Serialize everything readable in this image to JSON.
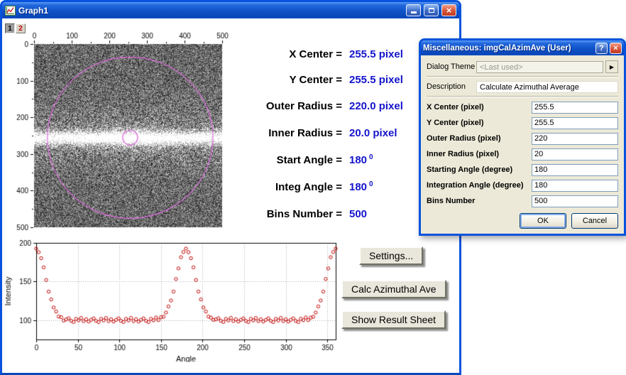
{
  "graph_window": {
    "title": "Graph1",
    "tabs": [
      "1",
      "2"
    ]
  },
  "window_controls": {
    "close": "×"
  },
  "annotations": [
    {
      "label": "X Center = ",
      "value": "255.5 pixel"
    },
    {
      "label": "Y Center = ",
      "value": "255.5 pixel"
    },
    {
      "label": "Outer Radius = ",
      "value": "220.0 pixel"
    },
    {
      "label": "Inner Radius = ",
      "value": "20.0 pixel"
    },
    {
      "label": "Start Angle = ",
      "value": "180",
      "sup": "0"
    },
    {
      "label": "Integ Angle = ",
      "value": "180",
      "sup": "0"
    },
    {
      "label": "Bins Number = ",
      "value": "500"
    }
  ],
  "graph_buttons": {
    "settings": "Settings...",
    "calc": "Calc Azimuthal Ave",
    "show": "Show Result Sheet"
  },
  "dialog": {
    "title": "Miscellaneous: imgCalAzimAve (User)",
    "help_glyph": "?",
    "close_glyph": "×",
    "theme_label": "Dialog Theme",
    "theme_value": "<Last used>",
    "theme_arrow": "▶",
    "description_label": "Description",
    "description_value": "Calculate Azimuthal Average",
    "fields": [
      {
        "label": "X Center (pixel)",
        "value": "255.5"
      },
      {
        "label": "Y Center (pixel)",
        "value": "255.5"
      },
      {
        "label": "Outer Radius (pixel)",
        "value": "220"
      },
      {
        "label": "Inner Radius (pixel)",
        "value": "20"
      },
      {
        "label": "Starting Angle (degree)",
        "value": "180"
      },
      {
        "label": "Integration Angle (degree)",
        "value": "180"
      },
      {
        "label": "Bins Number",
        "value": "500"
      }
    ],
    "ok_label": "OK",
    "cancel_label": "Cancel"
  },
  "chart_data": [
    {
      "type": "heatmap",
      "title": "FFT-magnitude grayscale noise image with bright horizontal center band",
      "xlim": [
        0,
        500
      ],
      "ylim": [
        0,
        500
      ],
      "y_direction": "down",
      "x_ticks": [
        0,
        100,
        200,
        300,
        400,
        500
      ],
      "y_ticks": [
        0,
        100,
        200,
        300,
        400,
        500
      ],
      "overlay_color": "#E06CE0",
      "overlays": [
        {
          "shape": "circle",
          "cx": 255.5,
          "cy": 255.5,
          "r": 220,
          "name": "outer-radius-roi"
        },
        {
          "shape": "circle",
          "cx": 255.5,
          "cy": 255.5,
          "r": 20,
          "name": "inner-radius-roi"
        }
      ]
    },
    {
      "type": "scatter",
      "title": "",
      "xlabel": "Angle",
      "ylabel": "Intensity",
      "xlim": [
        0,
        360
      ],
      "ylim": [
        75,
        200
      ],
      "x_ticks": [
        0,
        50,
        100,
        150,
        200,
        250,
        300,
        350
      ],
      "y_ticks": [
        100,
        150,
        200
      ],
      "grid": true,
      "legend": "none",
      "marker": "open-circle",
      "color": "#C00000",
      "points": [
        [
          0,
          192.6
        ],
        [
          3,
          187.9
        ],
        [
          6,
          180.2
        ],
        [
          9,
          168.3
        ],
        [
          12,
          152
        ],
        [
          15,
          137
        ],
        [
          18,
          126.8
        ],
        [
          21,
          116.4
        ],
        [
          24,
          111.2
        ],
        [
          27,
          104.7
        ],
        [
          30,
          103.9
        ],
        [
          33,
          99.5
        ],
        [
          36,
          101
        ],
        [
          39,
          102.5
        ],
        [
          42,
          99.2
        ],
        [
          45,
          97.6
        ],
        [
          48,
          101.7
        ],
        [
          51,
          99.7
        ],
        [
          54,
          102.9
        ],
        [
          57,
          98.8
        ],
        [
          60,
          101.2
        ],
        [
          63,
          98.2
        ],
        [
          66,
          100.4
        ],
        [
          69,
          102.3
        ],
        [
          72,
          99.1
        ],
        [
          75,
          97.6
        ],
        [
          78,
          101.7
        ],
        [
          81,
          99.7
        ],
        [
          84,
          102.9
        ],
        [
          87,
          98.8
        ],
        [
          90,
          101.2
        ],
        [
          93,
          98.2
        ],
        [
          96,
          100.4
        ],
        [
          99,
          102.3
        ],
        [
          102,
          99.1
        ],
        [
          105,
          97.6
        ],
        [
          108,
          101.7
        ],
        [
          111,
          99.7
        ],
        [
          114,
          102.9
        ],
        [
          117,
          98.8
        ],
        [
          120,
          101.2
        ],
        [
          123,
          98.2
        ],
        [
          126,
          100.4
        ],
        [
          129,
          102.3
        ],
        [
          132,
          99.1
        ],
        [
          135,
          97.6
        ],
        [
          138,
          101.7
        ],
        [
          141,
          99.7
        ],
        [
          144,
          103.5
        ],
        [
          147,
          100.1
        ],
        [
          150,
          103.9
        ],
        [
          153,
          104.4
        ],
        [
          156,
          109.9
        ],
        [
          159,
          117.7
        ],
        [
          162,
          125.5
        ],
        [
          165,
          137
        ],
        [
          168,
          153.3
        ],
        [
          171,
          167
        ],
        [
          174,
          181.5
        ],
        [
          177,
          188.2
        ],
        [
          180,
          192.6
        ],
        [
          183,
          187.9
        ],
        [
          186,
          180.2
        ],
        [
          189,
          168.3
        ],
        [
          192,
          152
        ],
        [
          195,
          137
        ],
        [
          198,
          126.8
        ],
        [
          201,
          116.4
        ],
        [
          204,
          111.2
        ],
        [
          207,
          104.7
        ],
        [
          210,
          103.3
        ],
        [
          213,
          100.4
        ],
        [
          216,
          101
        ],
        [
          219,
          102.5
        ],
        [
          222,
          99.2
        ],
        [
          225,
          97.6
        ],
        [
          228,
          101.7
        ],
        [
          231,
          99.7
        ],
        [
          234,
          102.9
        ],
        [
          237,
          98.8
        ],
        [
          240,
          101.2
        ],
        [
          243,
          98.2
        ],
        [
          246,
          100.4
        ],
        [
          249,
          102.3
        ],
        [
          252,
          99.1
        ],
        [
          255,
          97.6
        ],
        [
          258,
          101.7
        ],
        [
          261,
          99.7
        ],
        [
          264,
          102.9
        ],
        [
          267,
          98.8
        ],
        [
          270,
          101.2
        ],
        [
          273,
          98.2
        ],
        [
          276,
          100.4
        ],
        [
          279,
          102.3
        ],
        [
          282,
          99.1
        ],
        [
          285,
          97.6
        ],
        [
          288,
          101.7
        ],
        [
          291,
          99.7
        ],
        [
          294,
          102.9
        ],
        [
          297,
          98.8
        ],
        [
          300,
          101.2
        ],
        [
          303,
          98.2
        ],
        [
          306,
          100.4
        ],
        [
          309,
          102.3
        ],
        [
          312,
          99.1
        ],
        [
          315,
          97.6
        ],
        [
          318,
          101.8
        ],
        [
          321,
          99.9
        ],
        [
          324,
          103.5
        ],
        [
          327,
          100.1
        ],
        [
          330,
          103.3
        ],
        [
          333,
          104.4
        ],
        [
          336,
          109.9
        ],
        [
          339,
          117.7
        ],
        [
          342,
          125.5
        ],
        [
          345,
          137
        ],
        [
          348,
          153.3
        ],
        [
          351,
          167
        ],
        [
          354,
          181.5
        ],
        [
          357,
          188.2
        ],
        [
          360,
          192.6
        ]
      ]
    }
  ]
}
